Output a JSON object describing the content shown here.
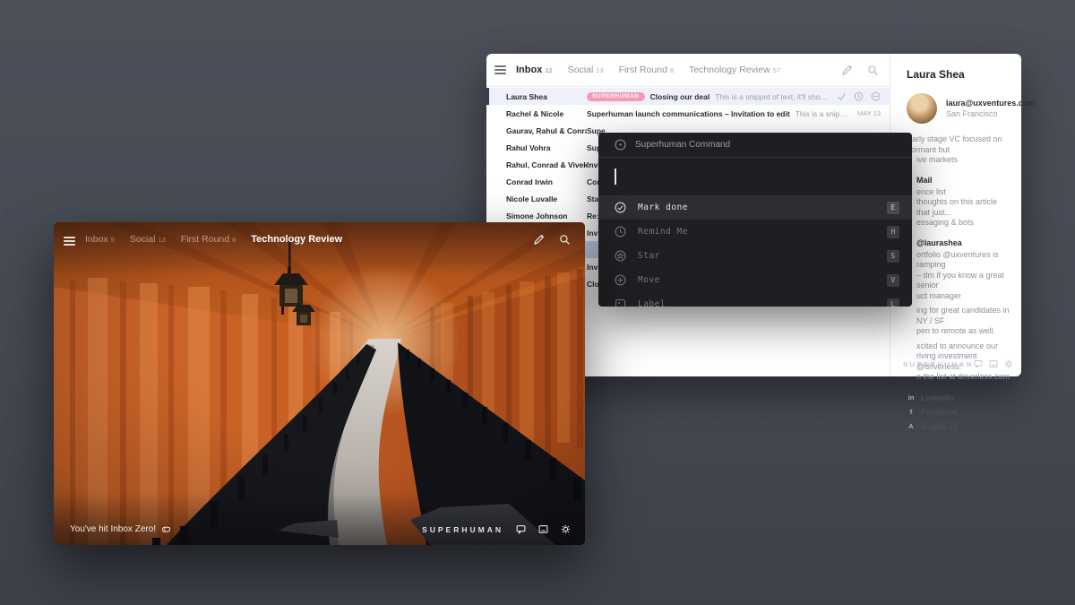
{
  "colors": {
    "background_top": "#4c5059",
    "background_bottom": "#3d4149",
    "badge_pink": "#f49ab5",
    "selected_row": "#eef0fa",
    "selected_row_blue": "#c9d6f0",
    "palette_bg": "#1e1f22",
    "torii_orange": "#c75f24"
  },
  "back": {
    "tabs": [
      {
        "label": "Inbox",
        "count": "12"
      },
      {
        "label": "Social",
        "count": "13"
      },
      {
        "label": "First Round",
        "count": "8"
      },
      {
        "label": "Technology Review",
        "count": "57"
      }
    ],
    "emails": [
      {
        "name": "Laura Shea",
        "badge": "SUPERHUMAN",
        "subject": "Closing our deal",
        "snippet": "This is a snippet of text, it'll show a preview of content inside..."
      },
      {
        "name": "Rachel & Nicole",
        "subject": "Superhuman launch communications – Invitation to edit",
        "snippet": "This is a snippet of text, it'll show a...",
        "date": "MAY 13"
      },
      {
        "name": "Gaurav, Rahul & Conrad",
        "subject": "Supe"
      },
      {
        "name": "Rahul Vohra",
        "subject": "Supe"
      },
      {
        "name": "Rahul, Conrad & Vivek",
        "subject": "Invita"
      },
      {
        "name": "Conrad Irwin",
        "subject": "Comp"
      },
      {
        "name": "Nicole Luvalle",
        "subject": "Start"
      },
      {
        "name": "Simone Johnson",
        "subject": "Re: h"
      },
      {
        "name": "",
        "subject": "Invit"
      },
      {
        "name": "",
        "subject": ""
      },
      {
        "name": "",
        "subject": "Invit"
      },
      {
        "name": "",
        "subject": "Closi"
      }
    ],
    "palette": {
      "title": "Superhuman Command",
      "input_value": "",
      "commands": [
        {
          "label": "Mark done",
          "key": "E"
        },
        {
          "label": "Remind Me",
          "key": "H"
        },
        {
          "label": "Star",
          "key": "S"
        },
        {
          "label": "Move",
          "key": "V"
        },
        {
          "label": "Label",
          "key": "L"
        }
      ]
    },
    "sidebar": {
      "name": "Laura Shea",
      "email": "laura@uxventures.com",
      "location": "San Francisco",
      "bio": [
        "Early stage VC focused on dormant but",
        "ive markets"
      ],
      "mail": {
        "title": "Mail",
        "items": [
          "ence list",
          "thoughts on this article that just...",
          "essaging & bots"
        ]
      },
      "twitter": {
        "handle": "@laurashea",
        "tweets": [
          [
            "ortfolio @uxventures is ramping",
            "– dm if you know a great senior",
            "uct manager"
          ],
          [
            "ing for great candidates in NY / SF",
            "pen to remote as well."
          ],
          [
            "xcited to announce our",
            "riving investment @driverless!",
            "n the list at driverless.com"
          ]
        ]
      },
      "links": [
        {
          "label": "LinkedIn"
        },
        {
          "label": "Facebook"
        },
        {
          "label": "AngelList"
        }
      ],
      "brand": "SUPERHUMAN"
    }
  },
  "front": {
    "tabs": [
      {
        "label": "Inbox",
        "count": "9"
      },
      {
        "label": "Social",
        "count": "13"
      },
      {
        "label": "First Round",
        "count": "8"
      },
      {
        "label": "Technology Review",
        "count": ""
      }
    ],
    "status": "You've hit Inbox Zero!",
    "brand": "SUPERHUMAN"
  }
}
